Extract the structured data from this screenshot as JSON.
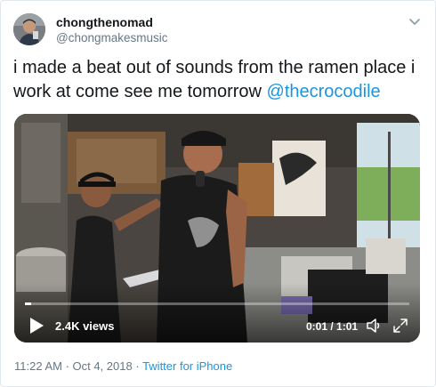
{
  "tweet": {
    "display_name": "chongthenomad",
    "handle": "@chongmakesmusic",
    "text": "i made a beat out of sounds from the ramen place i work at come see me tomorrow ",
    "mention": "@thecrocodile"
  },
  "video": {
    "views": "2.4K views",
    "time": "0:01 / 1:01",
    "progress_fraction": 0.016
  },
  "meta": {
    "timestamp": "11:22 AM · Oct 4, 2018",
    "separator": " · ",
    "source": "Twitter for iPhone"
  },
  "colors": {
    "link": "#1b95e0",
    "secondary_text": "#657786",
    "primary_text": "#14171a",
    "border": "#e1e8ed"
  },
  "icons": {
    "caret": "chevron-down-icon",
    "play": "play-icon",
    "volume": "volume-icon",
    "fullscreen": "fullscreen-icon"
  }
}
